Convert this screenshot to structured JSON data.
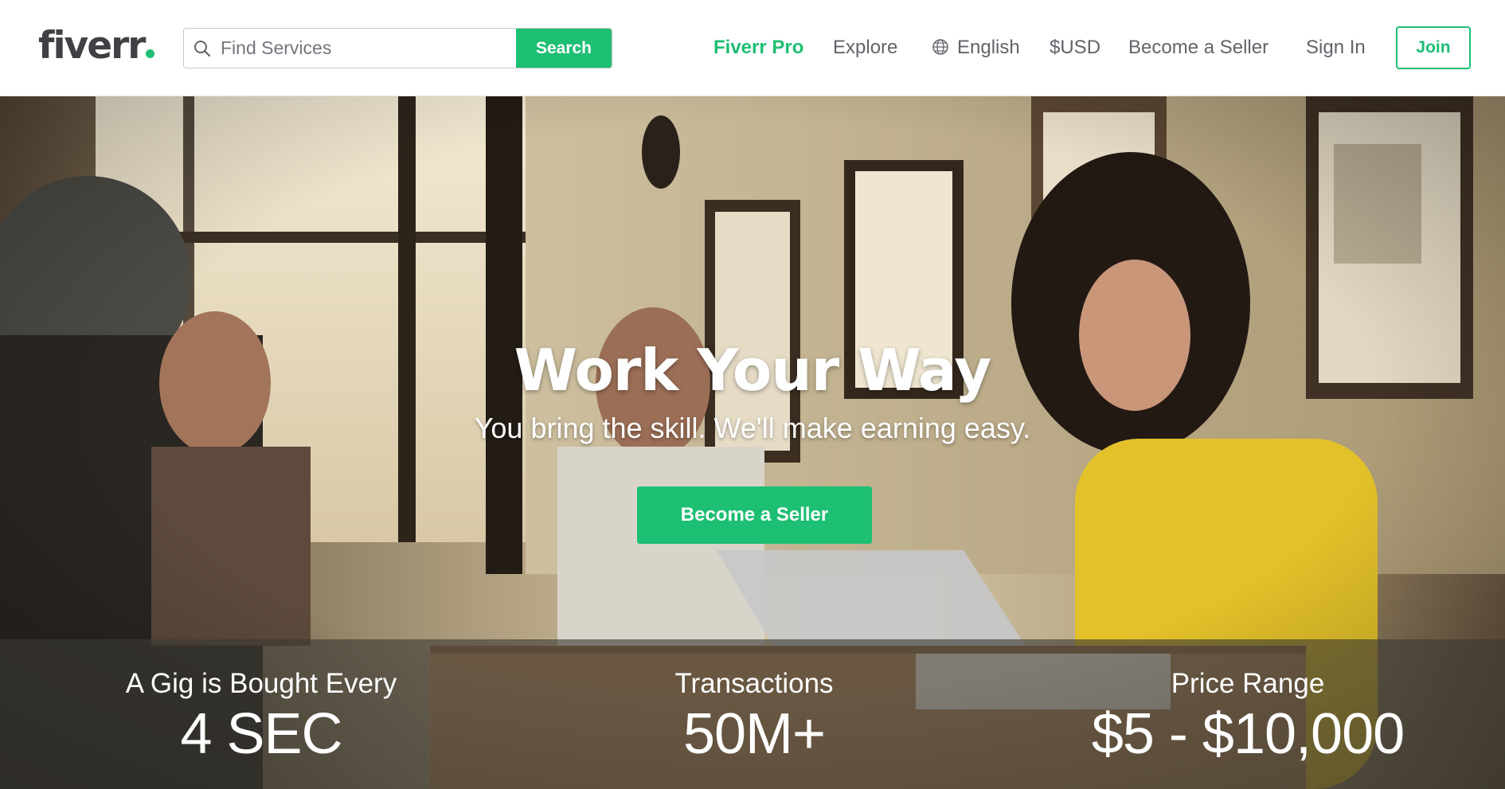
{
  "header": {
    "logo": "fiverr",
    "search": {
      "placeholder": "Find Services",
      "button_label": "Search"
    },
    "nav": {
      "fiverr_pro": "Fiverr Pro",
      "explore": "Explore",
      "language": "English",
      "currency": "$USD",
      "become_seller": "Become a Seller",
      "sign_in": "Sign In",
      "join": "Join"
    }
  },
  "hero": {
    "title": "Work Your Way",
    "subtitle": "You bring the skill. We'll make earning easy.",
    "cta_label": "Become a Seller"
  },
  "stats": [
    {
      "label": "A Gig is Bought Every",
      "value": "4 SEC"
    },
    {
      "label": "Transactions",
      "value": "50M+"
    },
    {
      "label": "Price Range",
      "value": "$5 - $10,000"
    }
  ],
  "colors": {
    "brand_green": "#1dbf73",
    "text_gray": "#62646a",
    "logo_dark": "#404145"
  },
  "icons": {
    "search": "search-icon",
    "globe": "globe-icon"
  }
}
